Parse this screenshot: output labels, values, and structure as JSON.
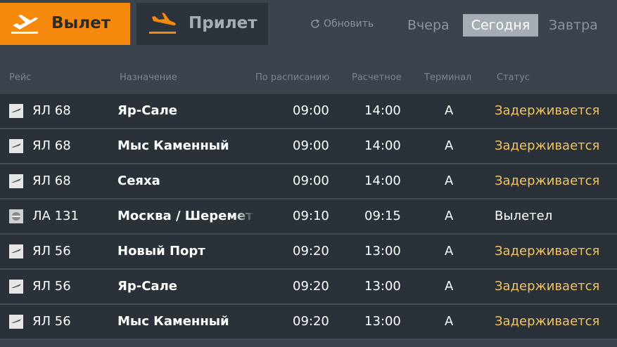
{
  "tabs": {
    "departure_label": "Вылет",
    "arrival_label": "Прилет",
    "refresh_label": "Обновить"
  },
  "days": {
    "yesterday": "Вчера",
    "today": "Сегодня",
    "tomorrow": "Завтра",
    "selected": "today"
  },
  "colors": {
    "accent": "#f58a0e",
    "delayed": "#f0c460",
    "background": "#3b434d",
    "row": "#2b3138"
  },
  "table": {
    "headers": {
      "flight": "Рейс",
      "destination": "Назначение",
      "scheduled": "По расписанию",
      "estimated": "Расчетное",
      "terminal": "Терминал",
      "status": "Статус"
    },
    "rows": [
      {
        "flight": "ЯЛ 68",
        "destination": "Яр-Сале",
        "scheduled": "09:00",
        "estimated": "14:00",
        "terminal": "A",
        "status": "Задерживается",
        "status_type": "delayed",
        "airline_icon": "yamal-logo-icon"
      },
      {
        "flight": "ЯЛ 68",
        "destination": "Мыс Каменный",
        "scheduled": "09:00",
        "estimated": "14:00",
        "terminal": "A",
        "status": "Задерживается",
        "status_type": "delayed",
        "airline_icon": "yamal-logo-icon"
      },
      {
        "flight": "ЯЛ 68",
        "destination": "Сеяха",
        "scheduled": "09:00",
        "estimated": "14:00",
        "terminal": "A",
        "status": "Задерживается",
        "status_type": "delayed",
        "airline_icon": "yamal-logo-icon"
      },
      {
        "flight": "ЛА 131",
        "destination": "Москва / Шереметьево",
        "scheduled": "09:10",
        "estimated": "09:15",
        "terminal": "A",
        "status": "Вылетел",
        "status_type": "departed",
        "airline_icon": "airline-logo-icon"
      },
      {
        "flight": "ЯЛ 56",
        "destination": "Новый Порт",
        "scheduled": "09:20",
        "estimated": "13:00",
        "terminal": "A",
        "status": "Задерживается",
        "status_type": "delayed",
        "airline_icon": "yamal-logo-icon"
      },
      {
        "flight": "ЯЛ 56",
        "destination": "Яр-Сале",
        "scheduled": "09:20",
        "estimated": "13:00",
        "terminal": "A",
        "status": "Задерживается",
        "status_type": "delayed",
        "airline_icon": "yamal-logo-icon"
      },
      {
        "flight": "ЯЛ 56",
        "destination": "Мыс Каменный",
        "scheduled": "09:20",
        "estimated": "13:00",
        "terminal": "A",
        "status": "Задерживается",
        "status_type": "delayed",
        "airline_icon": "yamal-logo-icon"
      }
    ]
  }
}
